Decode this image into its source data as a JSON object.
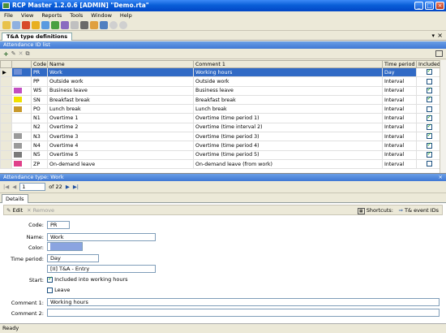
{
  "window": {
    "title": "RCP Master 1.2.0.6  [ADMIN] \"Demo.rta\""
  },
  "menu": [
    "File",
    "View",
    "Reports",
    "Tools",
    "Window",
    "Help"
  ],
  "document_tab": "T&A type definitions",
  "list_panel": {
    "title": "Attendance ID list"
  },
  "grid": {
    "columns": {
      "code": "Code",
      "name": "Name",
      "comment": "Comment 1",
      "period": "Time period",
      "included": "Included"
    },
    "rows": [
      {
        "color": "#6f8fd6",
        "code": "PR",
        "name": "Work",
        "comment": "Working hours",
        "period": "Day",
        "included": true,
        "selected": true
      },
      {
        "color": "",
        "code": "PP",
        "name": "Outside work",
        "comment": "Outside work",
        "period": "Interval",
        "included": false
      },
      {
        "color": "#c24fc2",
        "code": "WS",
        "name": "Business leave",
        "comment": "Business leave",
        "period": "Interval",
        "included": true
      },
      {
        "color": "#f0e000",
        "code": "SN",
        "name": "Breakfast break",
        "comment": "Breakfast break",
        "period": "Interval",
        "included": true
      },
      {
        "color": "#c89a2c",
        "code": "PO",
        "name": "Lunch break",
        "comment": "Lunch break",
        "period": "Interval",
        "included": false
      },
      {
        "color": "",
        "code": "N1",
        "name": "Overtime 1",
        "comment": "Overtime (time period 1)",
        "period": "Interval",
        "included": true
      },
      {
        "color": "",
        "code": "N2",
        "name": "Overtime 2",
        "comment": "Overtime (time interval 2)",
        "period": "Interval",
        "included": true
      },
      {
        "color": "#9a9a9a",
        "code": "N3",
        "name": "Overtime 3",
        "comment": "Overtime (time period 3)",
        "period": "Interval",
        "included": true
      },
      {
        "color": "#9a9a9a",
        "code": "N4",
        "name": "Overtime 4",
        "comment": "Overtime (time period 4)",
        "period": "Interval",
        "included": true
      },
      {
        "color": "#7a7a7a",
        "code": "N5",
        "name": "Overtime 5",
        "comment": "Overtime (time period 5)",
        "period": "Interval",
        "included": true
      },
      {
        "color": "#e0408a",
        "code": "ZP",
        "name": "On-demand leave",
        "comment": "On-demand leave (from work)",
        "period": "Interval",
        "included": false
      }
    ]
  },
  "detail_panel": {
    "title": "Attendance type: Work"
  },
  "navigator": {
    "position": "1",
    "total": "of 22"
  },
  "details_tab": "Details",
  "form_toolbar": {
    "edit": "Edit",
    "remove": "Remove",
    "shortcuts": "Shortcuts:",
    "ta_event_ids": "T& event IDs"
  },
  "form": {
    "code_label": "Code:",
    "code": "PR",
    "name_label": "Name:",
    "name": "Work",
    "color_label": "Color:",
    "color": "#8aa4e0",
    "period_label": "Time period:",
    "period": "Day",
    "entry_event": "[II]  T&A - Entry",
    "start_label": "Start:",
    "included_label": "Included into working hours",
    "included": true,
    "leave_label": "Leave",
    "leave": false,
    "comment1_label": "Comment 1:",
    "comment1": "Working hours",
    "comment2_label": "Comment 2:",
    "comment2": ""
  },
  "status": "Ready"
}
